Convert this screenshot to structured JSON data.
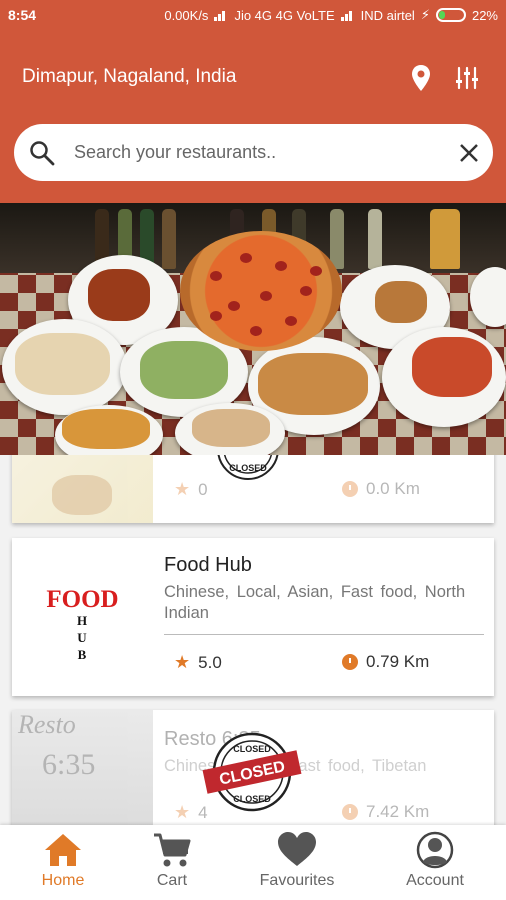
{
  "status_bar": {
    "time": "8:54",
    "speed": "0.00K/s",
    "carrier1": "Jio 4G 4G VoLTE",
    "carrier2": "IND airtel",
    "battery": "22%"
  },
  "header": {
    "location": "Dimapur, Nagaland, India",
    "search_placeholder": "Search your restaurants..",
    "pin_icon": "location-pin-icon",
    "filter_icon": "filter-sliders-icon",
    "accent_color": "#d0573a"
  },
  "restaurants": [
    {
      "name": "",
      "cuisine": "",
      "rating": "0",
      "distance": "0.0 Km",
      "closed": true,
      "stamp": "CLOSED"
    },
    {
      "name": "Food Hub",
      "cuisine": "Chinese,  Local,  Asian,  Fast food,  North Indian",
      "rating": "5.0",
      "distance": "0.79 Km",
      "closed": false,
      "logo_word1": "FOOD",
      "logo_word2": "HUB"
    },
    {
      "name": "Resto 6:35",
      "cuisine": "Chinese,  Local,  Fast food,  Tibetan",
      "rating": "4",
      "distance": "7.42 Km",
      "closed": true,
      "stamp": "CLOSED",
      "thumb_text1": "Resto",
      "thumb_text2": "6:35"
    }
  ],
  "bottom_nav": {
    "items": [
      {
        "label": "Home",
        "icon": "home-icon",
        "active": true
      },
      {
        "label": "Cart",
        "icon": "cart-icon",
        "active": false
      },
      {
        "label": "Favourites",
        "icon": "heart-icon",
        "active": false
      },
      {
        "label": "Account",
        "icon": "account-icon",
        "active": false
      }
    ],
    "active_color": "#e07a28"
  }
}
